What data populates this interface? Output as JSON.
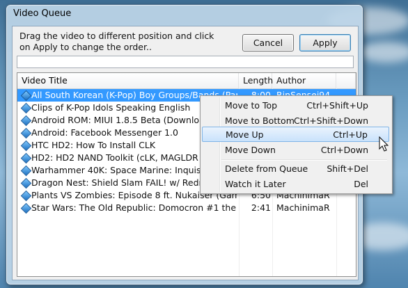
{
  "window": {
    "title": "Video Queue"
  },
  "instructions": "Drag the video to different position and click on Apply to change the order..",
  "buttons": {
    "cancel": "Cancel",
    "apply": "Apply"
  },
  "list": {
    "columns": [
      "Video Title",
      "Length",
      "Author"
    ],
    "rows": [
      {
        "title": "All South Korean (K-Pop) Boy Groups/Bands (Part 2",
        "length": "8:00",
        "author": "RinSensei94",
        "selected": true
      },
      {
        "title": "Clips of K-Pop Idols Speaking English",
        "length": "",
        "author": ""
      },
      {
        "title": "Android ROM: MIUI 1.8.5 Beta (Download Li",
        "length": "",
        "author": ""
      },
      {
        "title": "Android: Facebook Messenger 1.0",
        "length": "",
        "author": ""
      },
      {
        "title": "HTC HD2: How To Install CLK",
        "length": "",
        "author": ""
      },
      {
        "title": "HD2: HD2 NAND Toolkit (cLK, MAGLDR & Clo",
        "length": "",
        "author": ""
      },
      {
        "title": "Warhammer 40K: Space Marine: Inquisition g",
        "length": "",
        "author": ""
      },
      {
        "title": "Dragon Nest: Shield Slam FAIL! w/ Redneck",
        "length": "",
        "author": ""
      },
      {
        "title": "Plants VS Zombies: Episode 8 ft. Nukaiser (Gamepla",
        "length": "6:50",
        "author": "MachinimaR"
      },
      {
        "title": "Star Wars: The Old Republic: Domocron #1 the Je",
        "length": "2:41",
        "author": "MachinimaR"
      }
    ]
  },
  "context_menu": {
    "items": [
      {
        "label": "Move to Top",
        "shortcut": "Ctrl+Shift+Up"
      },
      {
        "label": "Move to Bottom",
        "shortcut": "Ctrl+Shift+Down"
      },
      {
        "label": "Move Up",
        "shortcut": "Ctrl+Up",
        "highlighted": true
      },
      {
        "label": "Move Down",
        "shortcut": "Ctrl+Down"
      },
      {
        "label": "Delete from Queue",
        "shortcut": "Shift+Del"
      },
      {
        "label": "Watch it Later",
        "shortcut": "Del"
      }
    ]
  },
  "colors": {
    "selection": "#3399ff",
    "menu_highlight": "#c9e2fb"
  }
}
